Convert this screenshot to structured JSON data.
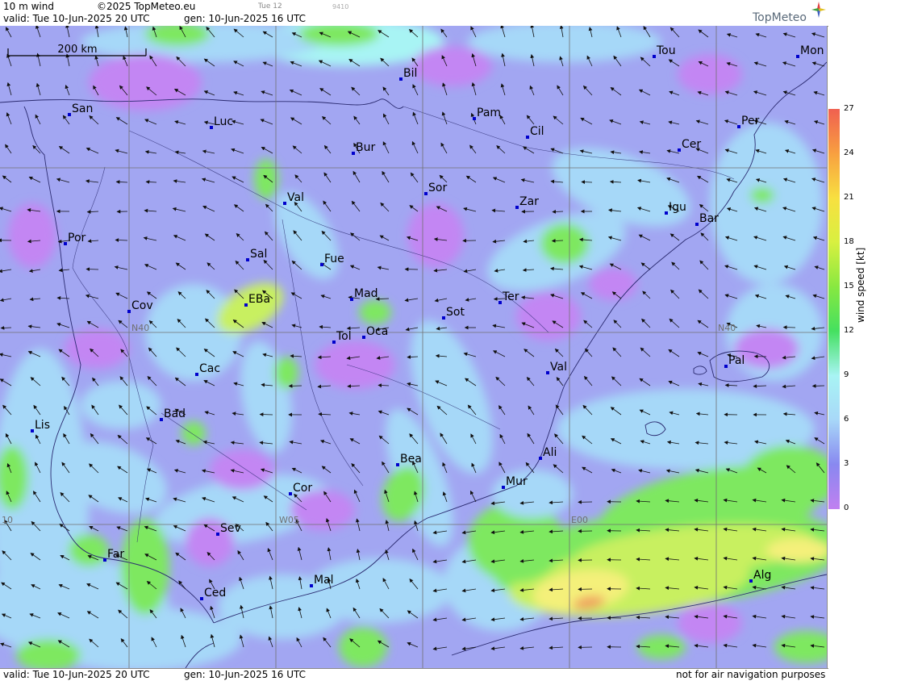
{
  "header": {
    "product": "10 m wind",
    "copyright": "©2025 TopMeteo.eu",
    "valid": "valid:  Tue  10-Jun-2025  20 UTC",
    "gen": "gen: 10-Jun-2025 16 UTC",
    "step": "Tue 12",
    "code": "9410",
    "brand": "TopMeteo"
  },
  "footer": {
    "valid": "valid:  Tue  10-Jun-2025  20 UTC",
    "gen": "gen: 10-Jun-2025 16 UTC",
    "disclaimer": "not for air navigation purposes"
  },
  "scale_bar": {
    "label": "200 km"
  },
  "grid_labels": [
    {
      "text": "N40"
    },
    {
      "text": "N40"
    },
    {
      "text": "W05"
    },
    {
      "text": "E00"
    },
    {
      "text": "10"
    }
  ],
  "cities": [
    {
      "name": "San"
    },
    {
      "name": "Luc"
    },
    {
      "name": "Bil"
    },
    {
      "name": "Pam"
    },
    {
      "name": "Cil"
    },
    {
      "name": "Tou"
    },
    {
      "name": "Mon"
    },
    {
      "name": "Per"
    },
    {
      "name": "Cer"
    },
    {
      "name": "Bur"
    },
    {
      "name": "Val"
    },
    {
      "name": "Sor"
    },
    {
      "name": "Zar"
    },
    {
      "name": "Igu"
    },
    {
      "name": "Bar"
    },
    {
      "name": "Por"
    },
    {
      "name": "Sal"
    },
    {
      "name": "Fue"
    },
    {
      "name": "Cov"
    },
    {
      "name": "EBa"
    },
    {
      "name": "Mad"
    },
    {
      "name": "Ter"
    },
    {
      "name": "Sot"
    },
    {
      "name": "Tol"
    },
    {
      "name": "Oca"
    },
    {
      "name": "Cac"
    },
    {
      "name": "Val"
    },
    {
      "name": "Pal"
    },
    {
      "name": "Bad"
    },
    {
      "name": "Lis"
    },
    {
      "name": "Bea"
    },
    {
      "name": "Ali"
    },
    {
      "name": "Mur"
    },
    {
      "name": "Cor"
    },
    {
      "name": "Sev"
    },
    {
      "name": "Far"
    },
    {
      "name": "Mal"
    },
    {
      "name": "Alg"
    },
    {
      "name": "Ced"
    }
  ],
  "legend": {
    "title": "wind speed  [kt]",
    "ticks": [
      "27",
      "24",
      "21",
      "18",
      "15",
      "12",
      "9",
      "6",
      "3",
      "0"
    ],
    "colors": [
      "#f06050",
      "#f8a040",
      "#f8e040",
      "#d8f040",
      "#88e840",
      "#44e060",
      "#a8f4f4",
      "#a8d8f8",
      "#8888f0",
      "#c080f0"
    ]
  }
}
